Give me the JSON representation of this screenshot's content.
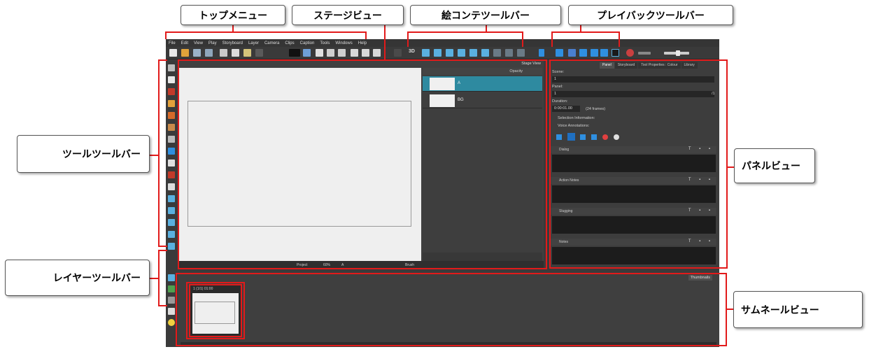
{
  "callouts": {
    "top_menu": "トップメニュー",
    "stage_view": "ステージビュー",
    "storyboard_toolbar": "絵コンテツールバー",
    "playback_toolbar": "プレイバックツールバー",
    "tools_toolbar": "ツールツールバー",
    "layer_toolbar": "レイヤーツールバー",
    "panel_view": "パネルビュー",
    "thumbnail_view": "サムネールビュー"
  },
  "menu": [
    "File",
    "Edit",
    "View",
    "Play",
    "Storyboard",
    "Layer",
    "Camera",
    "Clips",
    "Caption",
    "Tools",
    "Windows",
    "Help"
  ],
  "toolbar": {
    "three_d_label": "3D"
  },
  "stage": {
    "tab_label": "Stage View",
    "opacity_label": "Opacity",
    "layers": [
      {
        "name": "A"
      },
      {
        "name": "BG"
      }
    ],
    "status": {
      "project": "Project",
      "zoom": "60%",
      "layer": "A",
      "tool": "Brush"
    }
  },
  "panel": {
    "tabs": [
      "Panel",
      "Storyboard",
      "Tool Properties : Colour",
      "Library"
    ],
    "scene_label": "Scene:",
    "scene_value": "1",
    "panel_label": "Panel:",
    "panel_value": "1",
    "panel_total": "/1",
    "duration_label": "Duration:",
    "duration_value": "0:00:01.00",
    "duration_frames": "(24 frames)",
    "selection_info": "Selection Information:",
    "voice_annotations": "Voice Annotations:",
    "sections": [
      "Dialog",
      "Action Notes",
      "Slugging",
      "Notes"
    ]
  },
  "thumbnails": {
    "tab_label": "Thumbnails",
    "items": [
      {
        "label": "1 (1/1) 01:00"
      }
    ]
  },
  "colors": {
    "highlight_red": "#e21a1a",
    "app_bg": "#3b3b3b",
    "selected_layer": "#2e8aa0",
    "accent_blue": "#2f8fe0"
  }
}
